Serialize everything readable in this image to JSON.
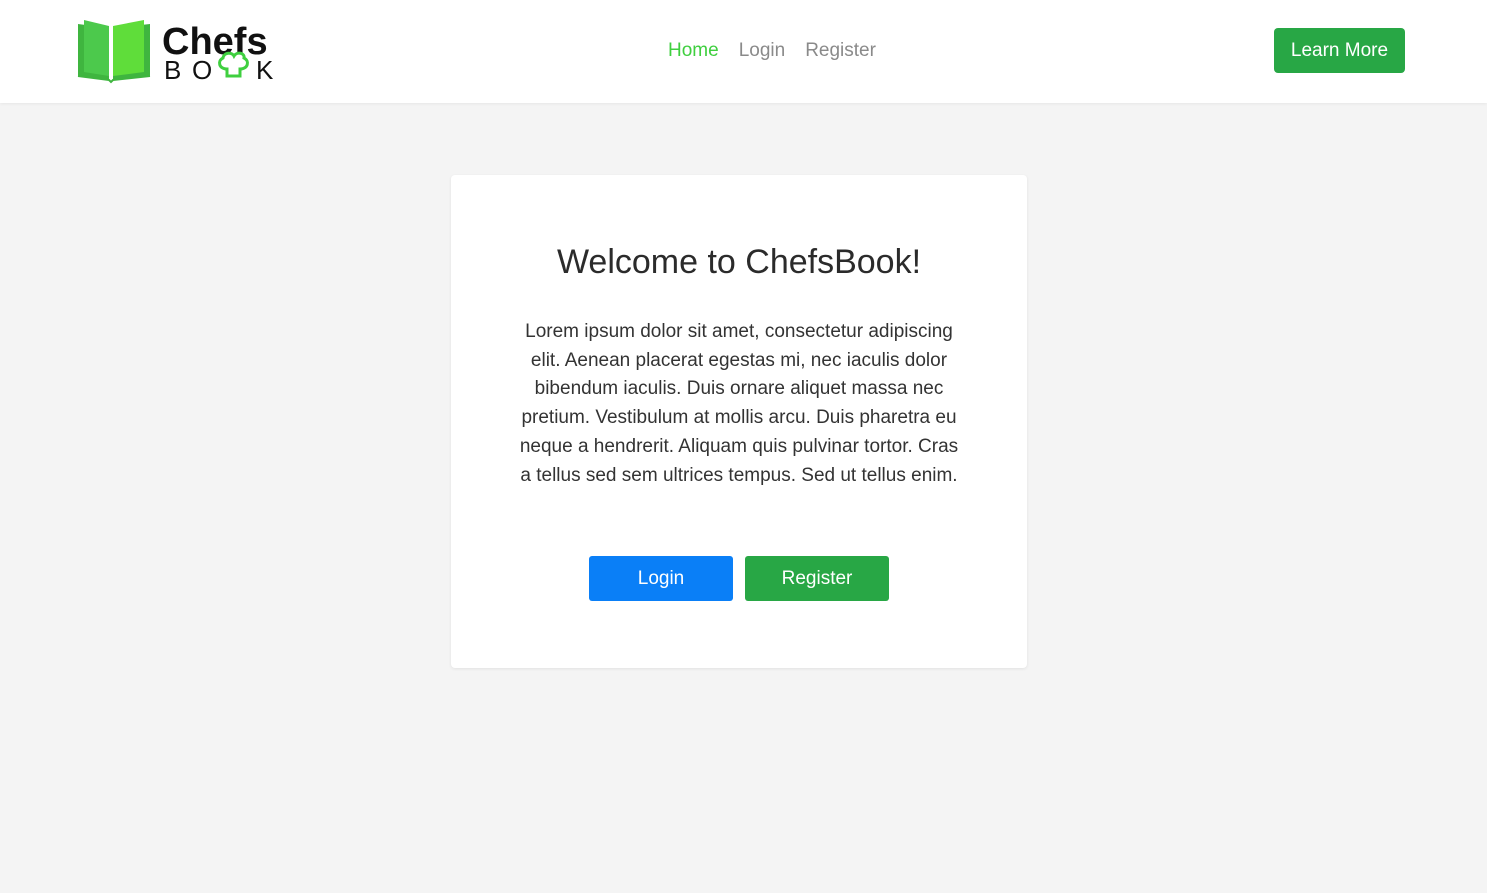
{
  "brand": {
    "name_top": "Chefs",
    "name_bottom": "BOOK"
  },
  "nav": {
    "links": [
      {
        "label": "Home",
        "active": true
      },
      {
        "label": "Login",
        "active": false
      },
      {
        "label": "Register",
        "active": false
      }
    ],
    "cta_label": "Learn More"
  },
  "card": {
    "title": "Welcome to ChefsBook!",
    "body": "Lorem ipsum dolor sit amet, consectetur adipiscing elit. Aenean placerat egestas mi, nec iaculis dolor bibendum iaculis. Duis ornare aliquet massa nec pretium. Vestibulum at mollis arcu. Duis pharetra eu neque a hendrerit. Aliquam quis pulvinar tortor. Cras a tellus sed sem ultrices tempus. Sed ut tellus enim.",
    "login_label": "Login",
    "register_label": "Register"
  },
  "colors": {
    "accent_green": "#28a745",
    "nav_active": "#3fcf3f",
    "login_blue": "#0a7ff7",
    "background": "#f4f4f4"
  },
  "icons": {
    "logo_book": "open-book-icon",
    "logo_chef_hat": "chef-hat-icon"
  }
}
